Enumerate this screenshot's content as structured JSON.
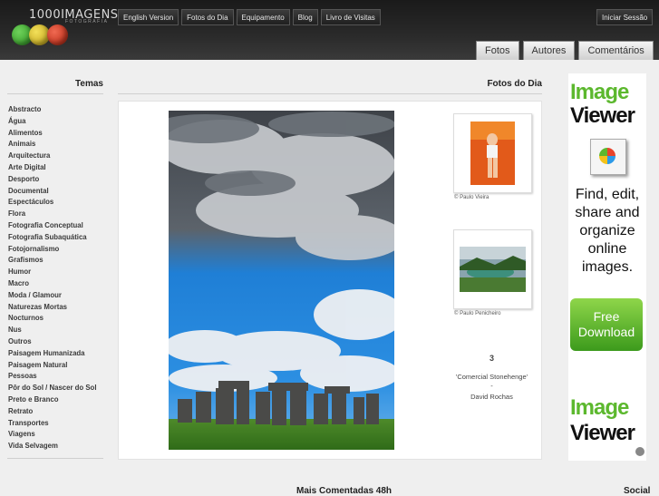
{
  "brand": {
    "name": "1000IMAGENS",
    "tagline": "FOTOGRAFIA"
  },
  "topnav": [
    "English Version",
    "Fotos do Dia",
    "Equipamento",
    "Blog",
    "Livro de Visitas"
  ],
  "login_label": "Iniciar Sessão",
  "subtabs": [
    "Fotos",
    "Autores",
    "Comentários"
  ],
  "sidebar": {
    "title": "Temas",
    "categories": [
      "Abstracto",
      "Água",
      "Alimentos",
      "Animais",
      "Arquitectura",
      "Arte Digital",
      "Desporto",
      "Documental",
      "Espectáculos",
      "Flora",
      "Fotografia Conceptual",
      "Fotografia Subaquática",
      "Fotojornalismo",
      "Grafismos",
      "Humor",
      "Macro",
      "Moda / Glamour",
      "Naturezas Mortas",
      "Nocturnos",
      "Nus",
      "Outros",
      "Paisagem Humanizada",
      "Paisagem Natural",
      "Pessoas",
      "Pôr do Sol / Nascer do Sol",
      "Preto e Branco",
      "Retrato",
      "Transportes",
      "Viagens",
      "Vida Selvagem"
    ]
  },
  "main": {
    "title": "Fotos do Dia",
    "thumbs": [
      {
        "caption": "© Paulo Vieira"
      },
      {
        "caption": "© Paulo Penicheiro"
      }
    ],
    "featured": {
      "count": "3",
      "photo_title": "'Comercial Stonehenge'",
      "separator": "-",
      "author": "David Rochas"
    }
  },
  "ad": {
    "word1": "Image",
    "word2": "Viewer",
    "lines": [
      "Find, edit,",
      "share and",
      "organize",
      "online",
      "images."
    ],
    "button": [
      "Free",
      "Download"
    ]
  },
  "bottom": {
    "left": "Mais Comentadas 48h",
    "right": "Social"
  },
  "colors": {
    "ad_blue": "#1e8fd6",
    "ad_green": "#5cb82e",
    "ad_dark": "#111111"
  }
}
